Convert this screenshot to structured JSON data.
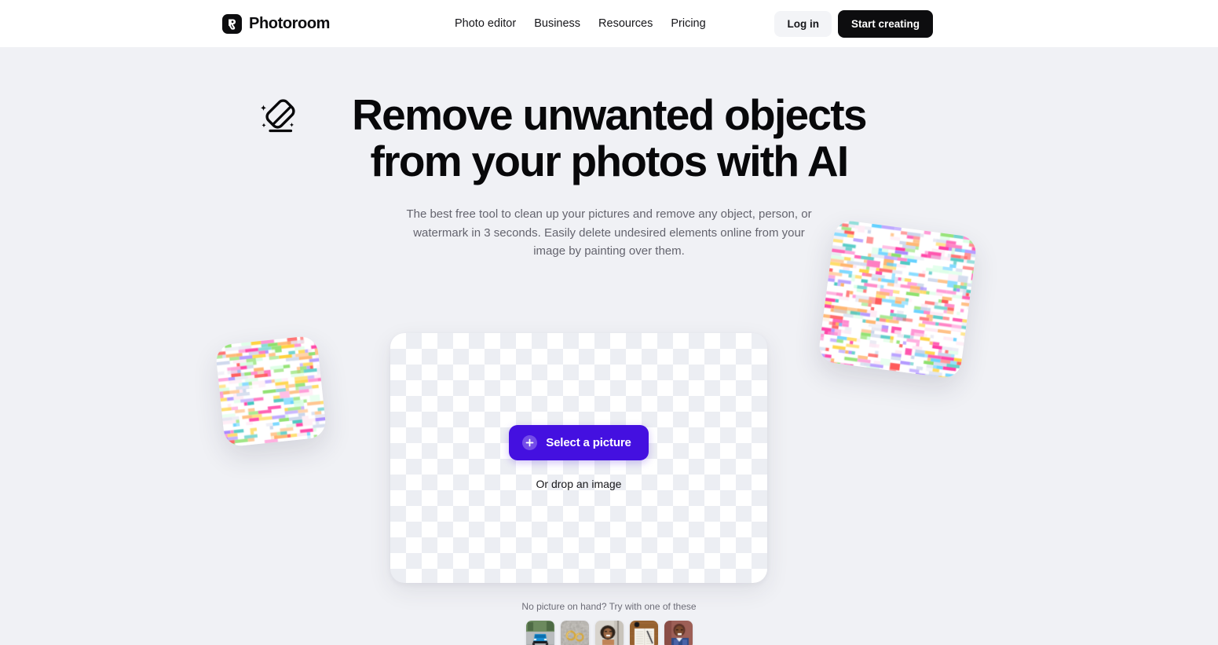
{
  "header": {
    "brand_name": "Photoroom",
    "logo_icon": "photoroom-logo-icon",
    "nav": [
      {
        "label": "Photo editor"
      },
      {
        "label": "Business"
      },
      {
        "label": "Resources"
      },
      {
        "label": "Pricing"
      }
    ],
    "login_label": "Log in",
    "start_label": "Start creating"
  },
  "hero": {
    "icon": "eraser-sparkle-icon",
    "headline_line1": "Remove unwanted objects",
    "headline_line2": "from your photos with AI",
    "subtitle": "The best free tool to clean up your pictures and remove any object, person, or watermark in 3 seconds. Easily delete undesired elements online from your image by painting over them."
  },
  "dropzone": {
    "select_label": "Select a picture",
    "plus_icon": "plus-icon",
    "drop_hint": "Or drop an image"
  },
  "samples": {
    "label": "No picture on hand? Try with one of these",
    "thumbs": [
      {
        "name": "sample-thumb-car",
        "alt": "blue car on road"
      },
      {
        "name": "sample-thumb-jewelry",
        "alt": "gold earrings on grey stone"
      },
      {
        "name": "sample-thumb-woman",
        "alt": "smiling woman portrait"
      },
      {
        "name": "sample-thumb-notebook",
        "alt": "open notebook on wooden desk"
      },
      {
        "name": "sample-thumb-man",
        "alt": "man in blue shirt portrait"
      }
    ]
  },
  "decor": [
    {
      "name": "pixelated-square-right"
    },
    {
      "name": "pixelated-square-left"
    }
  ],
  "colors": {
    "page_bg": "#f0f1f5",
    "header_bg": "#ffffff",
    "accent": "#4410e0",
    "text": "#0d0d0f",
    "muted_text": "#64646e"
  }
}
